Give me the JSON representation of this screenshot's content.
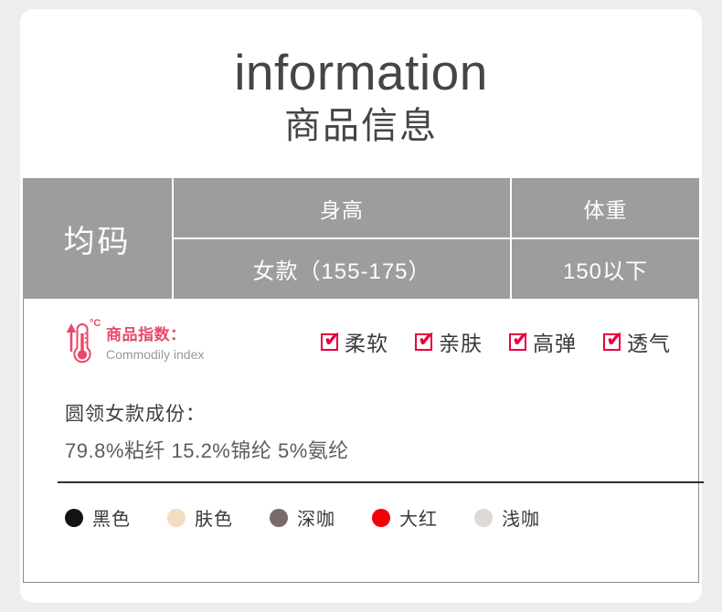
{
  "header": {
    "title_en": "information",
    "title_cn": "商品信息"
  },
  "size_table": {
    "size_label": "均码",
    "height_header": "身高",
    "weight_header": "体重",
    "height_value": "女款（155-175）",
    "weight_value": "150以下",
    "bg_color": "#9d9d9d",
    "text_color": "#ffffff"
  },
  "commodity_index": {
    "icon": "thermometer-icon",
    "degree_symbol": "°C",
    "label_cn": "商品指数：",
    "label_en": "Commodily index",
    "accent_color": "#e8496a",
    "features": [
      {
        "label": "柔软",
        "checked": true
      },
      {
        "label": "亲肤",
        "checked": true
      },
      {
        "label": "高弹",
        "checked": true
      },
      {
        "label": "透气",
        "checked": true
      }
    ],
    "check_color": "#e8003c"
  },
  "composition": {
    "title": "圆领女款成份：",
    "value": "79.8%粘纤  15.2%锦纶  5%氨纶"
  },
  "colors": [
    {
      "name": "黑色",
      "hex": "#141414"
    },
    {
      "name": "肤色",
      "hex": "#f5dcc0"
    },
    {
      "name": "深咖",
      "hex": "#786b68"
    },
    {
      "name": "大红",
      "hex": "#f40008"
    },
    {
      "name": "浅咖",
      "hex": "#ded8d6"
    }
  ]
}
